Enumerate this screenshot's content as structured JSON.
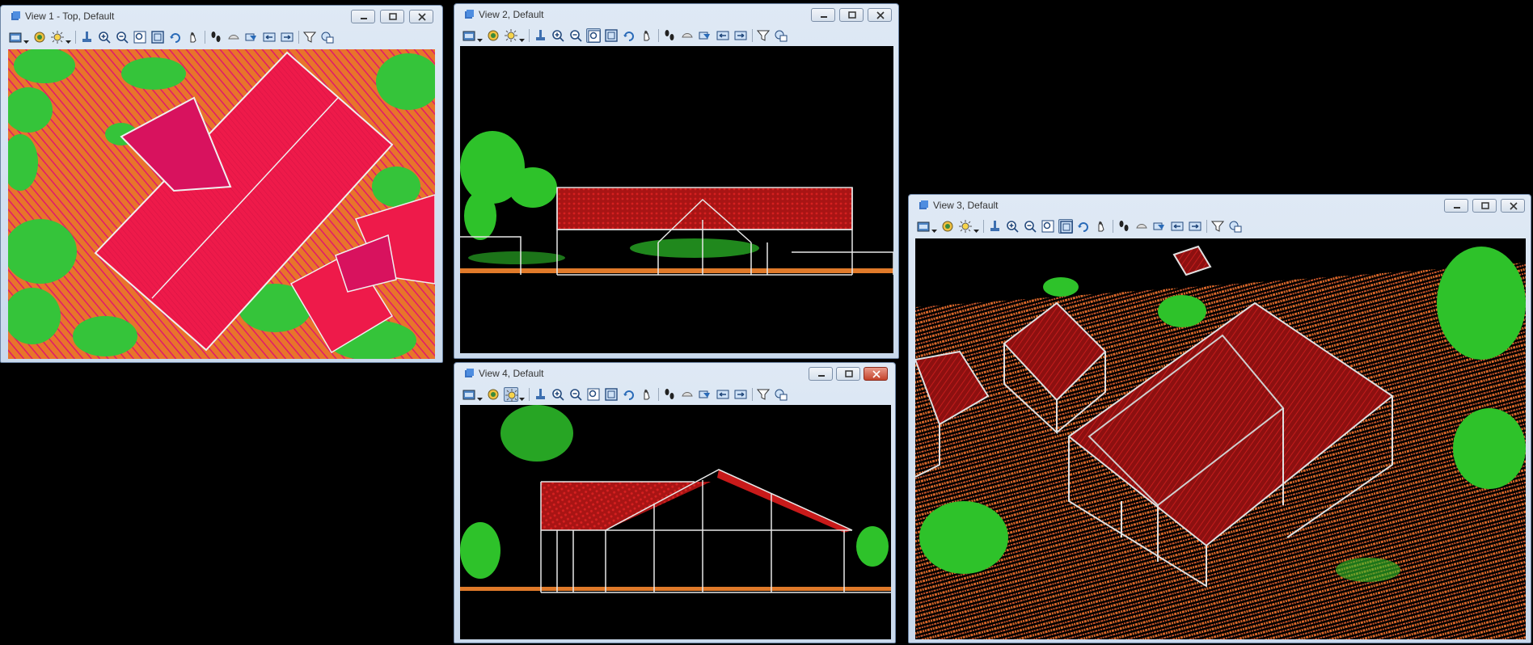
{
  "windows": [
    {
      "id": "view1",
      "title": "View 1 - Top, Default"
    },
    {
      "id": "view2",
      "title": "View 2, Default"
    },
    {
      "id": "view3",
      "title": "View 3, Default"
    },
    {
      "id": "view4",
      "title": "View 4, Default"
    }
  ],
  "colors": {
    "canvas_background": "#000000",
    "ground_points": "#e8742b",
    "roof_points_top": "#e8174a",
    "roof_points_side": "#b01616",
    "vegetation_points": "#2dcc28",
    "building_wireframe": "#e8e8e8",
    "title_bar": "#d3e0ef"
  },
  "toolbar_tools": [
    "view-attributes",
    "view-display-mode",
    "display-style",
    "clip-volume",
    "zoom-in",
    "zoom-out",
    "window-area",
    "fit-view",
    "rotate-view",
    "pan-view",
    "walk",
    "change-view-perspective",
    "copy-view",
    "previous-view",
    "next-view",
    "view-filter",
    "view-groups"
  ]
}
